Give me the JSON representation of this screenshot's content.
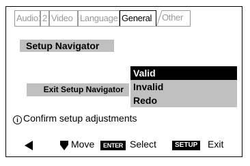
{
  "tabs": [
    {
      "label": "Audio1",
      "state": "inactive"
    },
    {
      "label": "2",
      "state": "inactive"
    },
    {
      "label": "Video",
      "state": "inactive"
    },
    {
      "label": "Language",
      "state": "inactive"
    },
    {
      "label": "General",
      "state": "active"
    },
    {
      "label": "Other",
      "state": "inactive"
    }
  ],
  "section_title": "Setup Navigator",
  "option": {
    "label": "Exit Setup Navigator"
  },
  "menu": {
    "items": [
      "Valid",
      "Invalid",
      "Redo"
    ],
    "selected": "Valid"
  },
  "status": {
    "icon": "info-icon",
    "text": "Confirm setup adjustments"
  },
  "help_bar": {
    "left_arrow_icon": "triangle-left-icon",
    "move_icon": "down-arrow-icon",
    "move_label": "Move",
    "enter_key": "ENTER",
    "select_label": "Select",
    "setup_key": "SETUP",
    "exit_label": "Exit"
  },
  "colors": {
    "highlight": "#000000",
    "panel": "#c0c0c0",
    "inactive_text": "#9a9a9a"
  }
}
